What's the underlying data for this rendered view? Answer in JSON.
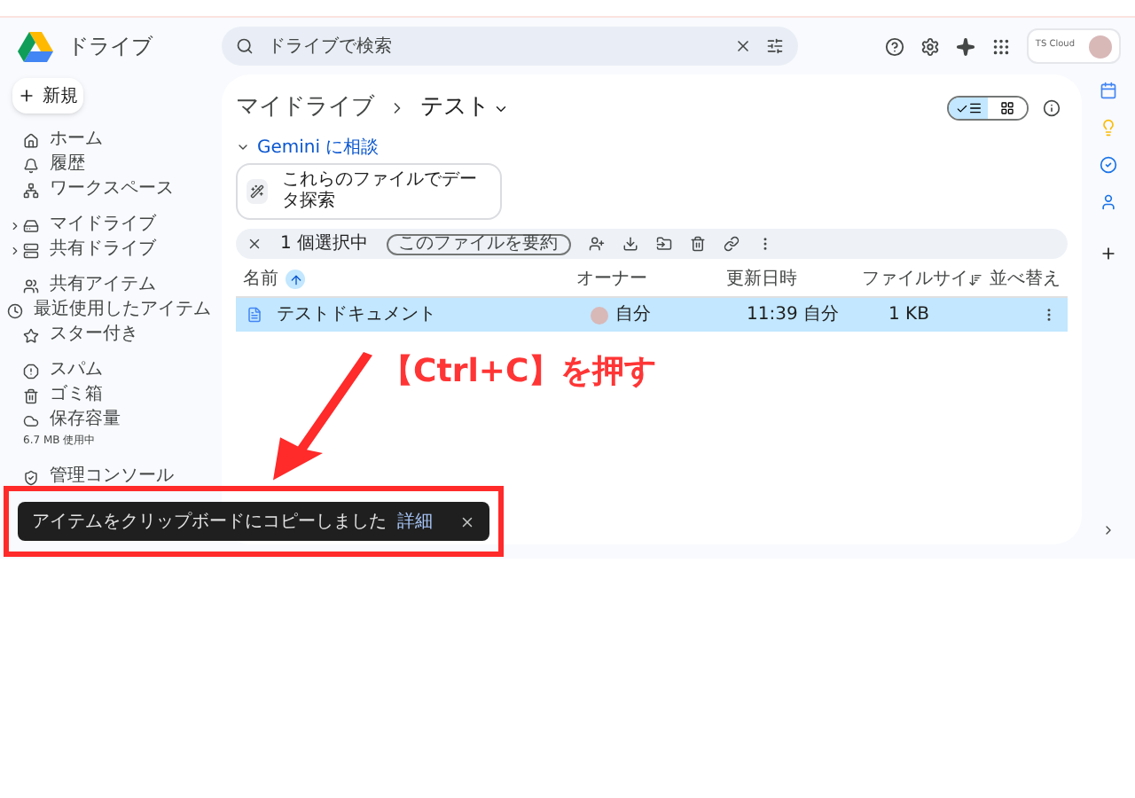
{
  "header": {
    "app_name": "ドライブ",
    "search": {
      "placeholder": "ドライブで検索"
    },
    "account": {
      "label": "TS Cloud"
    }
  },
  "sidebar": {
    "new_button": "新規",
    "groups": [
      [
        {
          "label": "ホーム",
          "expandable": false,
          "selected": false
        },
        {
          "label": "履歴",
          "expandable": false,
          "selected": false
        },
        {
          "label": "ワークスペース",
          "expandable": false,
          "selected": false
        }
      ],
      [
        {
          "label": "マイドライブ",
          "expandable": true,
          "selected": false
        },
        {
          "label": "共有ドライブ",
          "expandable": true,
          "selected": false
        }
      ],
      [
        {
          "label": "共有アイテム",
          "expandable": false,
          "selected": false
        },
        {
          "label": "最近使用したアイテム",
          "expandable": false,
          "selected": false
        },
        {
          "label": "スター付き",
          "expandable": false,
          "selected": false
        }
      ],
      [
        {
          "label": "スパム",
          "expandable": false,
          "selected": false
        },
        {
          "label": "ゴミ箱",
          "expandable": false,
          "selected": false
        },
        {
          "label": "保存容量",
          "expandable": false,
          "selected": false
        }
      ]
    ],
    "storage": "6.7 MB 使用中",
    "admin": {
      "label": "管理コンソール",
      "expandable": false,
      "selected": false
    }
  },
  "breadcrumb": [
    "マイドライブ",
    "テスト"
  ],
  "view_toggle": [
    {
      "kind": "list",
      "selected": true
    },
    {
      "kind": "grid",
      "selected": false
    }
  ],
  "gemini": {
    "label": "Gemini に相談",
    "expanded": true,
    "suggestion": "これらのファイルでデータ探索"
  },
  "selection_bar": {
    "count": "1 個選択中",
    "summarize": "このファイルを要約"
  },
  "table": {
    "columns": [
      "名前",
      "オーナー",
      "更新日時",
      "ファイルサイ"
    ],
    "sort": "並べ替え",
    "rows": [
      {
        "name": "テストドキュメント",
        "owner": "自分",
        "modified": "11:39 自分",
        "size": "1 KB",
        "selected": true
      }
    ]
  },
  "toast": {
    "message": "アイテムをクリップボードにコピーしました",
    "action": "詳細"
  },
  "annotation": {
    "text": "【Ctrl+C】を押す"
  }
}
